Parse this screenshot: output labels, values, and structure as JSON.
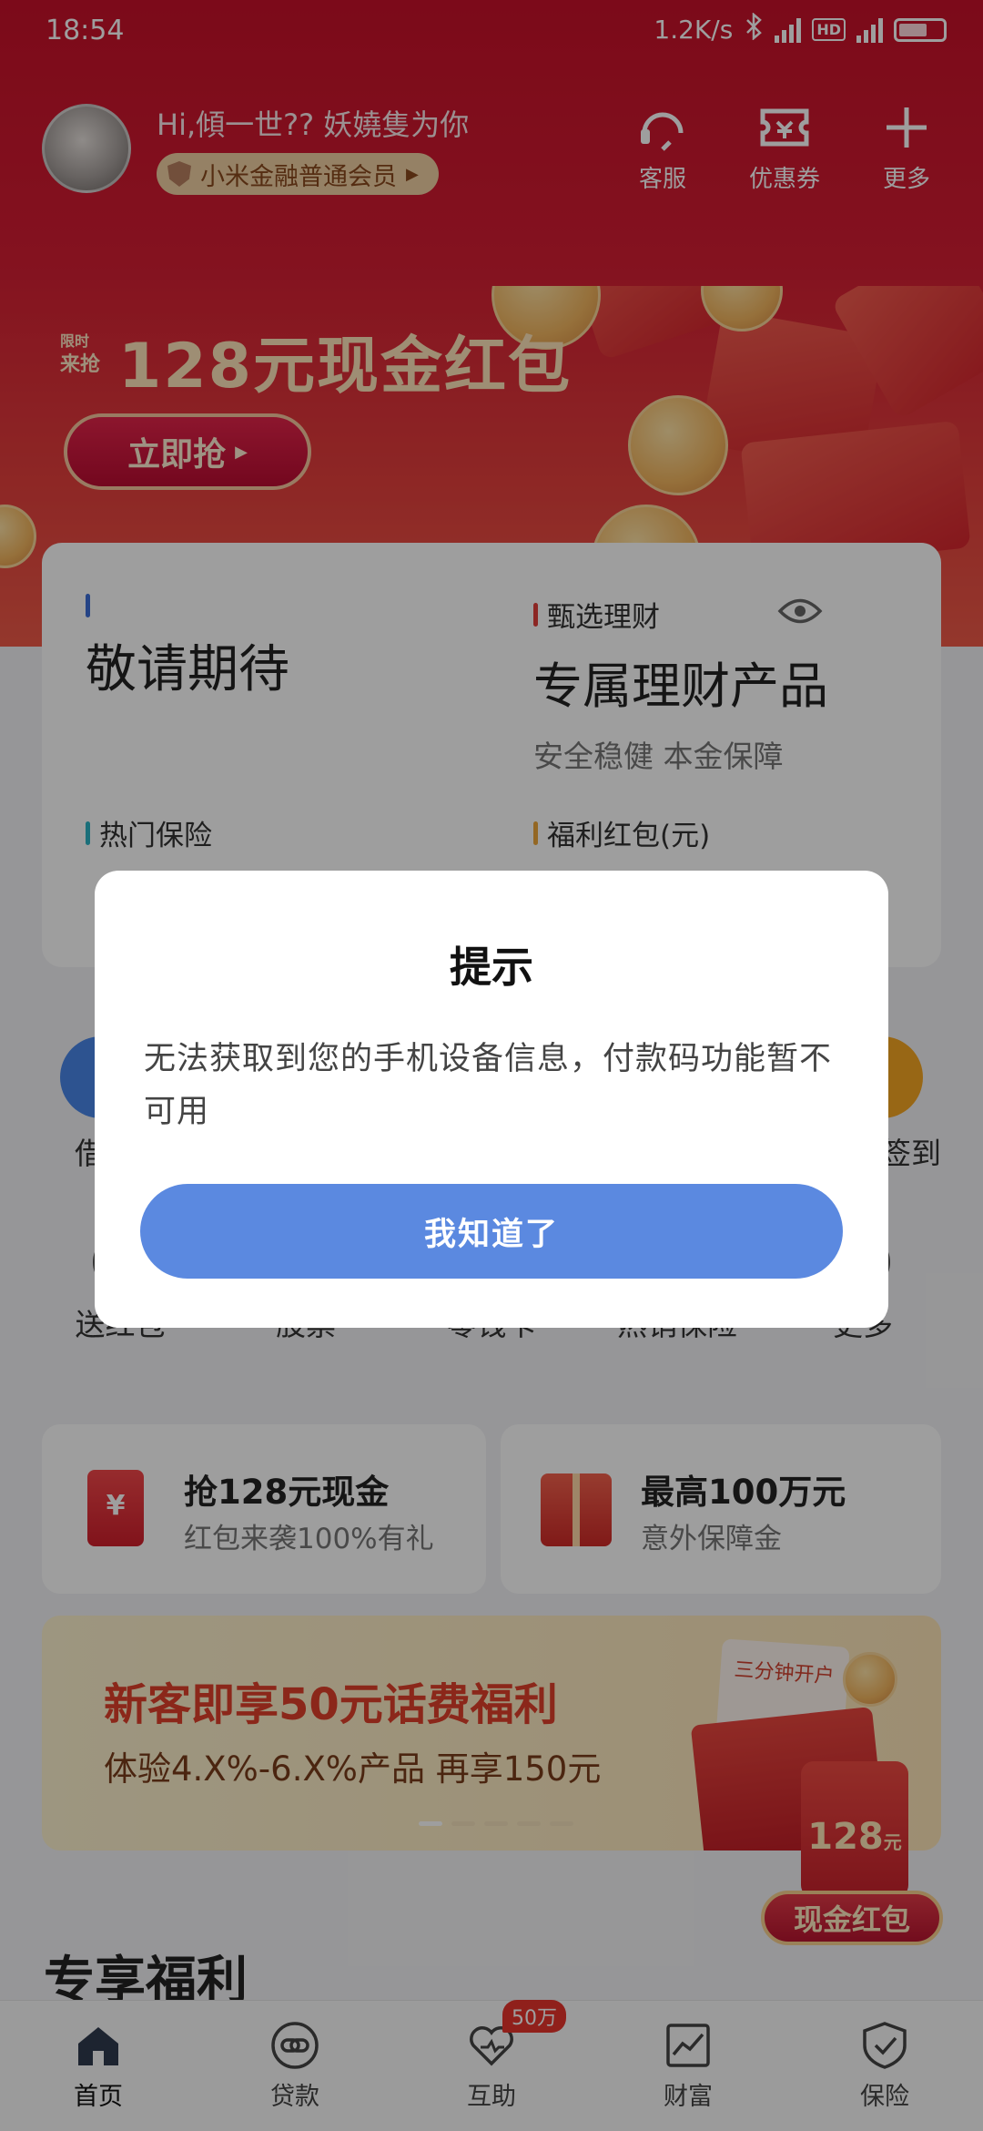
{
  "status_bar": {
    "time": "18:54",
    "speed": "1.2K/s",
    "hd": "HD",
    "net1": "3G",
    "net2": "4G"
  },
  "profile": {
    "greeting": "Hi,傾一世?? 妖嬈隻为你",
    "member": "小米金融普通会员"
  },
  "top_actions": [
    {
      "label": "客服",
      "icon": "headset-icon"
    },
    {
      "label": "优惠券",
      "icon": "ticket-icon"
    },
    {
      "label": "更多",
      "icon": "plus-icon"
    }
  ],
  "banner": {
    "tag_line1": "限时",
    "tag_line2": "来抢",
    "headline": "128元现金红包",
    "button": "立即抢"
  },
  "cards": {
    "c1": {
      "label": "",
      "value": "敬请期待"
    },
    "c2": {
      "label": "甄选理财",
      "value": "专属理财产品",
      "sub": "安全稳健  本金保障"
    },
    "c3": {
      "label": "热门保险"
    },
    "c4": {
      "label": "福利红包(元)"
    }
  },
  "icons_row1": [
    {
      "label": "借"
    },
    {
      "label": "签到"
    }
  ],
  "icons_row2": [
    {
      "label": "送红包"
    },
    {
      "label": "股票"
    },
    {
      "label": "零钱卡"
    },
    {
      "label": "热销保险"
    },
    {
      "label": "更多"
    }
  ],
  "promos": [
    {
      "title": "抢128元现金",
      "sub": "红包来袭100%有礼",
      "icon": "red-envelope-icon"
    },
    {
      "title": "最高100万元",
      "sub": "意外保障金",
      "icon": "gift-box-icon"
    }
  ],
  "new_customer": {
    "title": "新客即享50元话费福利",
    "sub": "体验4.X%-6.X%产品 再享150元",
    "stamp": "三分钟开户"
  },
  "float_red": {
    "amount": "128",
    "unit": "元",
    "label": "现金红包"
  },
  "section_title": "专享福利",
  "tabs": [
    {
      "label": "首页",
      "icon": "home-icon"
    },
    {
      "label": "贷款",
      "icon": "link-icon"
    },
    {
      "label": "互助",
      "icon": "heart-icon",
      "badge": "50万"
    },
    {
      "label": "财富",
      "icon": "chart-icon"
    },
    {
      "label": "保险",
      "icon": "shield-check-icon"
    }
  ],
  "dialog": {
    "title": "提示",
    "message": "无法获取到您的手机设备信息，付款码功能暂不可用",
    "ok": "我知道了"
  }
}
